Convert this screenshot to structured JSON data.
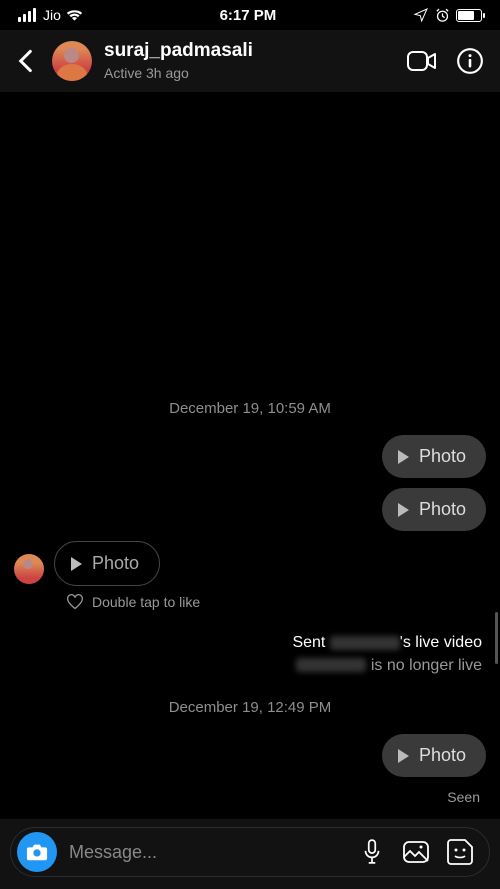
{
  "status_bar": {
    "carrier": "Jio",
    "time": "6:17 PM"
  },
  "header": {
    "username": "suraj_padmasali",
    "presence": "Active 3h ago"
  },
  "timeline": {
    "ts1": "December 19, 10:59 AM",
    "ts2": "December 19, 12:49 PM",
    "photo_label": "Photo",
    "double_tap": "Double tap to like",
    "live_line1_prefix": "Sent ",
    "live_line1_suffix": "'s live video",
    "live_line2_suffix": " is no longer live",
    "seen": "Seen"
  },
  "composer": {
    "placeholder": "Message..."
  }
}
